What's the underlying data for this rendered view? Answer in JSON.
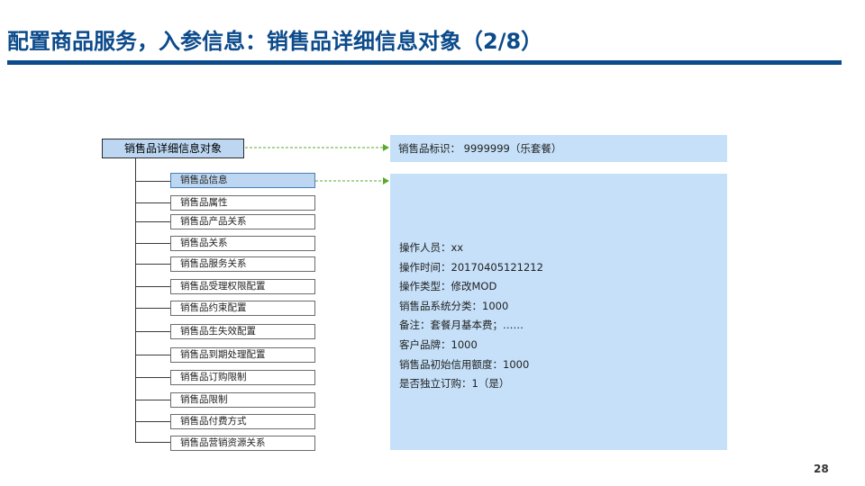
{
  "slide": {
    "title": "配置商品服务，入参信息：销售品详细信息对象（2/8）",
    "page_number": "28"
  },
  "tree": {
    "root_label": "销售品详细信息对象",
    "items": [
      {
        "label": "销售品信息"
      },
      {
        "label": "销售品属性"
      },
      {
        "label": "销售品产品关系"
      },
      {
        "label": "销售品关系"
      },
      {
        "label": "销售品服务关系"
      },
      {
        "label": "销售品受理权限配置"
      },
      {
        "label": "销售品约束配置"
      },
      {
        "label": "销售品生失效配置"
      },
      {
        "label": "销售品到期处理配置"
      },
      {
        "label": "销售品订购限制"
      },
      {
        "label": "销售品限制"
      },
      {
        "label": "销售品付费方式"
      },
      {
        "label": "销售品营销资源关系"
      }
    ]
  },
  "id_panel": {
    "text": "销售品标识：  9999999（乐套餐）"
  },
  "detail_panel": {
    "lines": [
      "操作人员：xx",
      "操作时间：20170405121212",
      "操作类型：修改MOD",
      "销售品系统分类：1000",
      "备注：套餐月基本费；……",
      "客户品牌：1000",
      "销售品初始信用额度：1000",
      "是否独立订购：1（是）"
    ]
  },
  "colors": {
    "title": "#0b4a8b",
    "panel": "#c5e0f8",
    "active_box": "#bdd7f2",
    "connector": "#5aaa2c"
  }
}
